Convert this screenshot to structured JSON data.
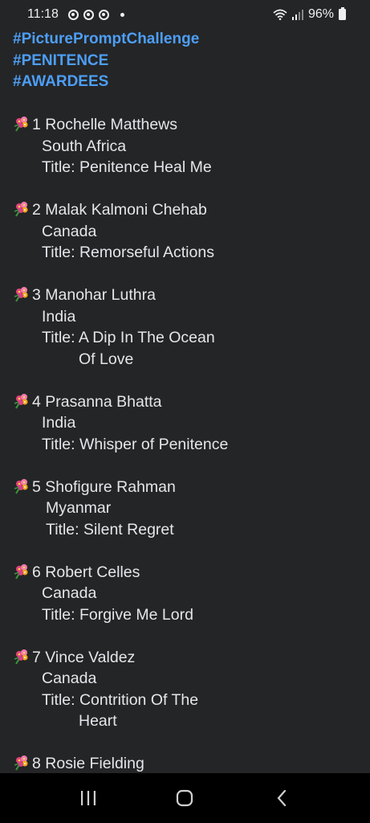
{
  "status_bar": {
    "time": "11:18",
    "battery": "96%"
  },
  "hashtags": [
    "#PicturePromptChallenge",
    "#PENITENCE",
    "#AWARDEES"
  ],
  "entries": [
    {
      "line1": "1 Rochelle Matthews",
      "line2": "South Africa",
      "line3": "Title: Penitence Heal Me",
      "line4": ""
    },
    {
      "line1": "2 Malak Kalmoni Chehab",
      "line2": "Canada",
      "line3": "Title: Remorseful Actions",
      "line4": ""
    },
    {
      "line1": "3 Manohar Luthra",
      "line2": "India",
      "line3": "Title: A Dip In The Ocean",
      "line4": "Of Love"
    },
    {
      "line1": "4 Prasanna Bhatta",
      "line2": "India",
      "line3": "Title: Whisper of Penitence",
      "line4": ""
    },
    {
      "line1": "5 Shofigure Rahman",
      "line2": "Myanmar",
      "line3": "Title: Silent Regret",
      "line4": ""
    },
    {
      "line1": "6 Robert Celles",
      "line2": "Canada",
      "line3": "Title: Forgive Me Lord",
      "line4": ""
    },
    {
      "line1": "7 Vince Valdez",
      "line2": "Canada",
      "line3": "Title: Contrition Of The",
      "line4": "Heart"
    },
    {
      "line1": "8 Rosie Fielding",
      "line2": "",
      "line3": "",
      "line4": ""
    }
  ],
  "nav": {
    "recents_icon": "recents-icon",
    "home_icon": "home-icon",
    "back_icon": "back-icon"
  }
}
